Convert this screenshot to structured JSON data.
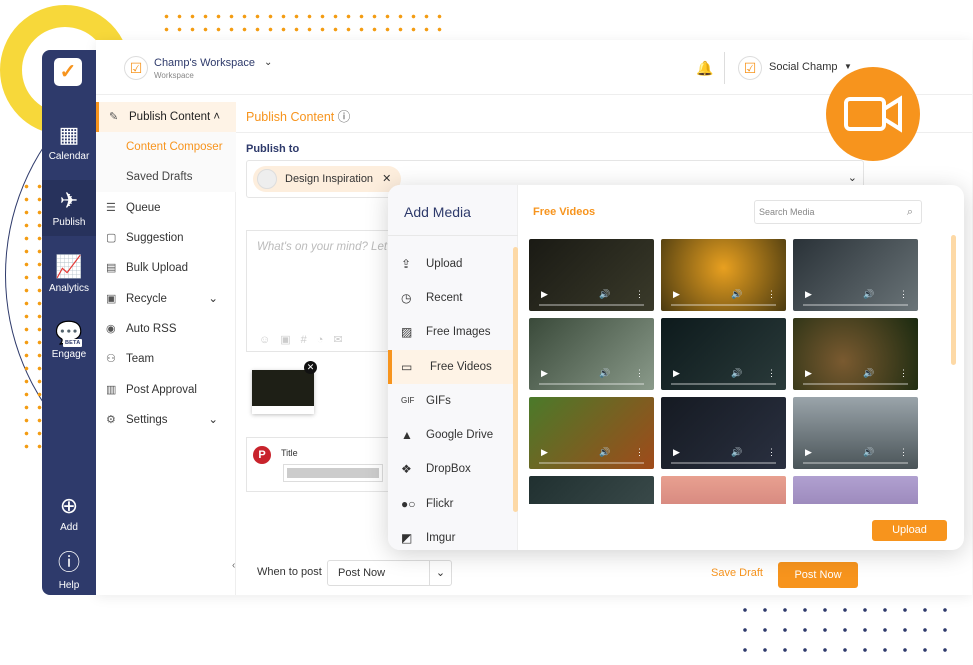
{
  "workspace": {
    "name": "Champ's Workspace",
    "sub": "Workspace"
  },
  "user": {
    "name": "Social Champ"
  },
  "rail": [
    {
      "label": "Calendar",
      "icon": "calendar-icon"
    },
    {
      "label": "Publish",
      "icon": "paper-plane-icon"
    },
    {
      "label": "Analytics",
      "icon": "analytics-icon"
    },
    {
      "label": "Engage",
      "icon": "chat-icon",
      "badge": "BETA"
    },
    {
      "label": "Add",
      "icon": "plus-icon"
    },
    {
      "label": "Help",
      "icon": "help-icon"
    }
  ],
  "sidebar": {
    "section": "Publish Content",
    "sub": [
      "Content Composer",
      "Saved Drafts"
    ],
    "items": [
      "Queue",
      "Suggestion",
      "Bulk Upload",
      "Recycle",
      "Auto RSS",
      "Team",
      "Post Approval",
      "Settings"
    ]
  },
  "composer": {
    "title": "Publish Content",
    "publish_to": "Publish to",
    "account": "Design Inspiration",
    "placeholder": "What's on your mind? Let t",
    "pin_title": "Title",
    "when_label": "When to post",
    "when_value": "Post Now",
    "save_draft": "Save Draft",
    "post_now": "Post Now"
  },
  "media": {
    "title": "Add Media",
    "items": [
      "Upload",
      "Recent",
      "Free Images",
      "Free Videos",
      "GIFs",
      "Google Drive",
      "DropBox",
      "Flickr",
      "Imgur"
    ],
    "active": "Free Videos",
    "section": "Free Videos",
    "search_placeholder": "Search Media",
    "upload": "Upload"
  },
  "colors": {
    "accent": "#f7941d",
    "navy": "#2e3a6b"
  }
}
